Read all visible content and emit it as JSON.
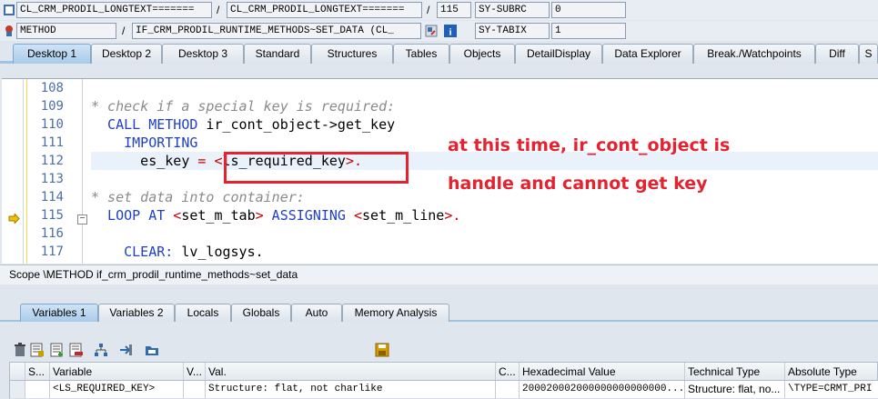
{
  "top_row1": {
    "field1": "CL_CRM_PRODIL_LONGTEXT=======",
    "sep1": "/",
    "field2": "CL_CRM_PRODIL_LONGTEXT=======",
    "sep2": "/",
    "line_no": "115",
    "sysvar_name": "SY-SUBRC",
    "sysvar_value": "0"
  },
  "top_row2": {
    "event_type": "METHOD",
    "sep": "/",
    "event_name": "IF_CRM_PRODIL_RUNTIME_METHODS~SET_DATA (CL_",
    "sysvar_name": "SY-TABIX",
    "sysvar_value": "1"
  },
  "desktop_tabs": [
    "Desktop 1",
    "Desktop 2",
    "Desktop 3",
    "Standard",
    "Structures",
    "Tables",
    "Objects",
    "DetailDisplay",
    "Data Explorer",
    "Break./Watchpoints",
    "Diff",
    "S"
  ],
  "code": {
    "line_numbers": [
      "108",
      "109",
      "110",
      "111",
      "112",
      "113",
      "114",
      "115",
      "116",
      "117"
    ],
    "lines": [
      [],
      [
        {
          "t": "* check if a special key is required:",
          "c": "cm"
        }
      ],
      [
        {
          "t": "  CALL METHOD",
          "c": "kw"
        },
        {
          "t": " ir_cont_object->get_key",
          "c": "pl"
        }
      ],
      [
        {
          "t": "    IMPORTING",
          "c": "kw"
        }
      ],
      [
        {
          "t": "      es_key ",
          "c": "pl"
        },
        {
          "t": "=",
          "c": "pt"
        },
        {
          "t": " <",
          "c": "pt"
        },
        {
          "t": "ls_required_key",
          "c": "pl"
        },
        {
          "t": ">.",
          "c": "pt"
        }
      ],
      [],
      [
        {
          "t": "* set data into container:",
          "c": "cm"
        }
      ],
      [
        {
          "t": "  LOOP AT",
          "c": "kw"
        },
        {
          "t": " <",
          "c": "pt"
        },
        {
          "t": "set_m_tab",
          "c": "pl"
        },
        {
          "t": ">",
          "c": "pt"
        },
        {
          "t": " ASSIGNING",
          "c": "kw"
        },
        {
          "t": " <",
          "c": "pt"
        },
        {
          "t": "set_m_line",
          "c": "pl"
        },
        {
          "t": ">.",
          "c": "pt"
        }
      ],
      [],
      [
        {
          "t": "    CLEAR:",
          "c": "kw"
        },
        {
          "t": " lv_logsys.",
          "c": "pl"
        }
      ]
    ],
    "annotation_line1": "at this time, ir_cont_object is",
    "annotation_line2": "handle and cannot get key"
  },
  "scope": "Scope \\METHOD if_crm_prodil_runtime_methods~set_data",
  "variable_tabs": [
    "Variables 1",
    "Variables 2",
    "Locals",
    "Globals",
    "Auto",
    "Memory Analysis"
  ],
  "grid": {
    "headers": [
      "S...",
      "Variable",
      "V...",
      "Val.",
      "C...",
      "Hexadecimal Value",
      "Technical Type",
      "Absolute Type"
    ],
    "rows": [
      [
        "",
        "<LS_REQUIRED_KEY>",
        "",
        "Structure: flat, not charlike",
        "",
        "200020002000000000000000...",
        "Structure: flat, no...",
        "\\TYPE=CRMT_PRI"
      ]
    ]
  },
  "colors": {
    "accent": "#9ec3e6",
    "annotation": "#e52330",
    "keyword": "#2040c8"
  }
}
